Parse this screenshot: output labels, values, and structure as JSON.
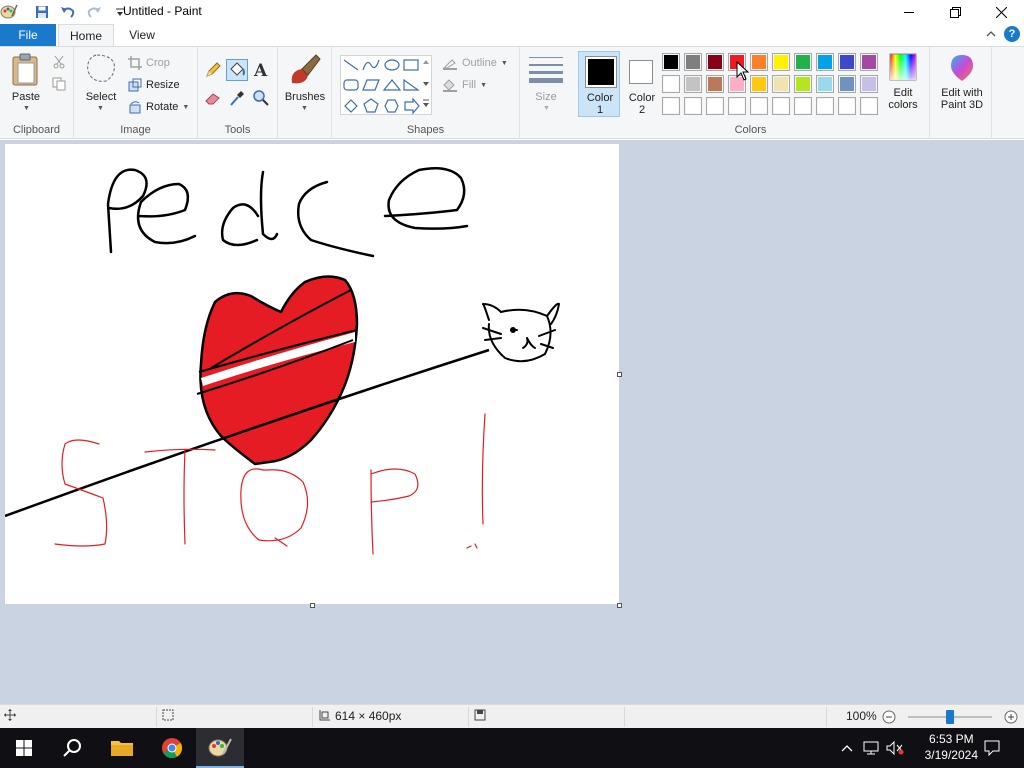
{
  "window": {
    "title": "Untitled - Paint"
  },
  "tabs": {
    "file": "File",
    "home": "Home",
    "view": "View",
    "help": "?"
  },
  "clipboard": {
    "paste": "Paste",
    "group": "Clipboard"
  },
  "image": {
    "select": "Select",
    "crop": "Crop",
    "resize": "Resize",
    "rotate": "Rotate",
    "group": "Image"
  },
  "tools": {
    "group": "Tools"
  },
  "brushes": {
    "label": "Brushes"
  },
  "shapes": {
    "outline": "Outline",
    "fill": "Fill",
    "group": "Shapes"
  },
  "size": {
    "label": "Size"
  },
  "colors": {
    "color1_line1": "Color",
    "color1_line2": "1",
    "color2_line1": "Color",
    "color2_line2": "2",
    "color1_value": "#000000",
    "color2_value": "#ffffff",
    "group": "Colors",
    "edit_line1": "Edit",
    "edit_line2": "colors",
    "paint3d_line1": "Edit with",
    "paint3d_line2": "Paint 3D",
    "palette_row1": [
      "#000000",
      "#7f7f7f",
      "#880015",
      "#ed1c24",
      "#ff7f27",
      "#fff200",
      "#22b14c",
      "#00a2e8",
      "#3f48cc",
      "#a349a4"
    ],
    "palette_row2": [
      "#ffffff",
      "#c3c3c3",
      "#b97a57",
      "#ffaec9",
      "#ffc90e",
      "#efe4b0",
      "#b5e61d",
      "#99d9ea",
      "#7092be",
      "#c8bfe7"
    ],
    "palette_row3": [
      "#ffffff",
      "#ffffff",
      "#ffffff",
      "#ffffff",
      "#ffffff",
      "#ffffff",
      "#ffffff",
      "#ffffff",
      "#ffffff",
      "#ffffff"
    ]
  },
  "statusbar": {
    "dimensions": "614 × 460px",
    "zoom": "100%"
  },
  "taskbar": {
    "time": "6:53 PM",
    "date": "3/19/2024"
  }
}
